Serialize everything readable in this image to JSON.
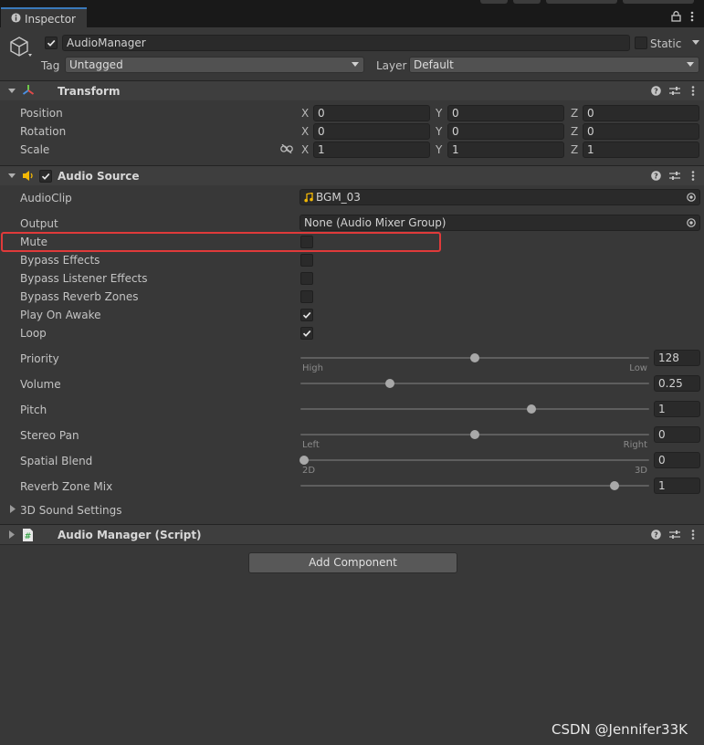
{
  "window": {
    "tab_label": "Inspector"
  },
  "object": {
    "name": "AudioManager",
    "static_label": "Static",
    "tag_label": "Tag",
    "tag_value": "Untagged",
    "layer_label": "Layer",
    "layer_value": "Default"
  },
  "transform": {
    "title": "Transform",
    "rows": [
      {
        "label": "Position",
        "x": "0",
        "y": "0",
        "z": "0"
      },
      {
        "label": "Rotation",
        "x": "0",
        "y": "0",
        "z": "0"
      },
      {
        "label": "Scale",
        "x": "1",
        "y": "1",
        "z": "1"
      }
    ],
    "axis_x": "X",
    "axis_y": "Y",
    "axis_z": "Z"
  },
  "audio_source": {
    "title": "Audio Source",
    "audioclip_label": "AudioClip",
    "audioclip_value": "BGM_03",
    "output_label": "Output",
    "output_value": "None (Audio Mixer Group)",
    "toggles": [
      {
        "label": "Mute",
        "checked": false
      },
      {
        "label": "Bypass Effects",
        "checked": false
      },
      {
        "label": "Bypass Listener Effects",
        "checked": false
      },
      {
        "label": "Bypass Reverb Zones",
        "checked": false
      },
      {
        "label": "Play On Awake",
        "checked": true
      },
      {
        "label": "Loop",
        "checked": true
      }
    ],
    "sliders": [
      {
        "label": "Priority",
        "value": "128",
        "fraction": 0.5,
        "min_label": "High",
        "max_label": "Low"
      },
      {
        "label": "Volume",
        "value": "0.25",
        "fraction": 0.25,
        "min_label": "",
        "max_label": ""
      },
      {
        "label": "Pitch",
        "value": "1",
        "fraction": 0.667,
        "min_label": "",
        "max_label": ""
      },
      {
        "label": "Stereo Pan",
        "value": "0",
        "fraction": 0.5,
        "min_label": "Left",
        "max_label": "Right"
      },
      {
        "label": "Spatial Blend",
        "value": "0",
        "fraction": 0.0,
        "min_label": "2D",
        "max_label": "3D"
      },
      {
        "label": "Reverb Zone Mix",
        "value": "1",
        "fraction": 0.909,
        "min_label": "",
        "max_label": ""
      }
    ],
    "sound_settings_label": "3D Sound Settings"
  },
  "script": {
    "title": "Audio Manager (Script)"
  },
  "add_component_label": "Add Component",
  "watermark": "CSDN @Jennifer33K",
  "colors": {
    "highlight_box": "#e03a3a",
    "tab_accent": "#3a79bb",
    "audio_icon": "#f2b705",
    "script_icon": "#3aa64a"
  }
}
